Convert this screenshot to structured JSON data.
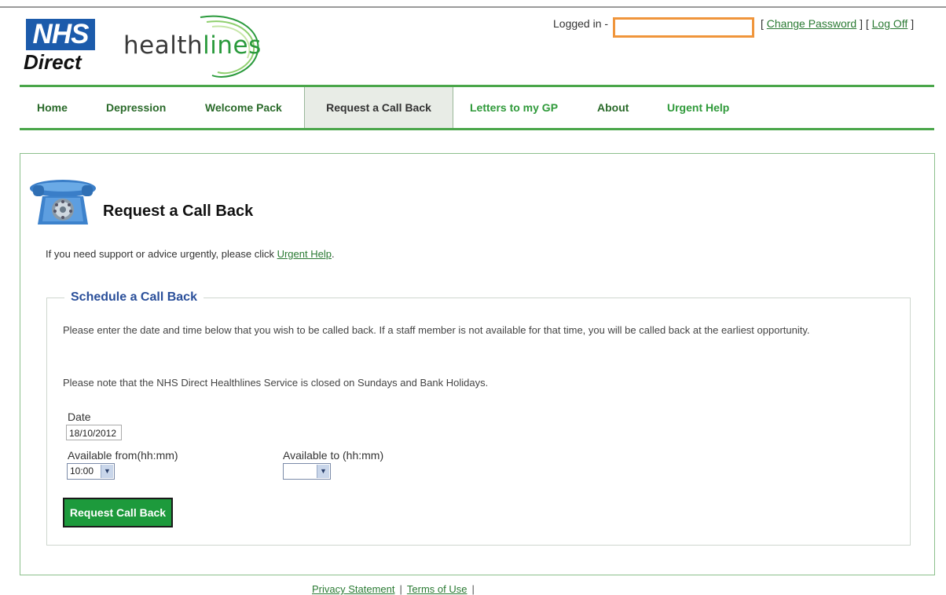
{
  "header": {
    "logo_top": "NHS",
    "logo_bottom": "Direct",
    "brand_plain": "health",
    "brand_accent": "lines",
    "logged_in_label": "Logged in -",
    "logged_in_value": "",
    "links": {
      "open1": "[ ",
      "change_password": "Change Password",
      "mid": " ] [ ",
      "log_off": "Log Off",
      "close": " ]"
    }
  },
  "nav": {
    "items": [
      {
        "label": "Home"
      },
      {
        "label": "Depression"
      },
      {
        "label": "Welcome Pack"
      },
      {
        "label": "Request a Call Back"
      },
      {
        "label": "Letters to my GP"
      },
      {
        "label": "About"
      },
      {
        "label": "Urgent Help"
      }
    ]
  },
  "page": {
    "title": "Request a Call Back",
    "urgent_prefix": "If you need support or advice urgently, please click ",
    "urgent_link": "Urgent Help",
    "urgent_suffix": "."
  },
  "form": {
    "legend": "Schedule a Call Back",
    "para1": "Please enter the date and time below that you wish to be called back. If a staff member is not available for that time, you will be called back at the earliest opportunity.",
    "para2": "Please note that the NHS Direct Healthlines Service is closed on Sundays and Bank Holidays.",
    "date_label": "Date",
    "date_value": "18/10/2012",
    "from_label": "Available from(hh:mm)",
    "from_value": "10:00",
    "to_label": "Available to (hh:mm)",
    "to_value": "",
    "submit_label": "Request Call Back"
  },
  "footer": {
    "privacy": "Privacy Statement",
    "terms": "Terms of Use",
    "sep": "|"
  },
  "colors": {
    "nhs_blue": "#1c5bab",
    "nav_green": "#4aa64a",
    "button_green": "#1d9a3c",
    "legend_blue": "#2a4f9a",
    "login_highlight": "#f0953b"
  }
}
